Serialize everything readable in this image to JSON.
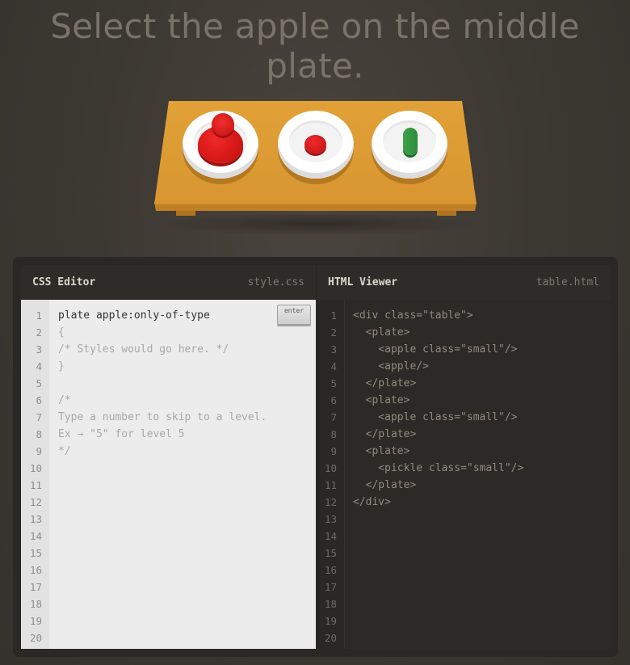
{
  "instruction": "Select the apple on the middle plate.",
  "css_editor": {
    "title": "CSS Editor",
    "file": "style.css",
    "input_value": "plate apple:only-of-type",
    "enter_label": "enter",
    "lines": [
      "{",
      "/* Styles would go here. */",
      "}",
      "",
      "/*",
      "Type a number to skip to a level.",
      "Ex → \"5\" for level 5",
      "*/"
    ],
    "line_numbers": [
      "1",
      "2",
      "3",
      "4",
      "5",
      "6",
      "7",
      "8",
      "9",
      "10",
      "11",
      "12",
      "13",
      "14",
      "15",
      "16",
      "17",
      "18",
      "19",
      "20"
    ]
  },
  "html_viewer": {
    "title": "HTML Viewer",
    "file": "table.html",
    "lines": [
      "<div class=\"table\">",
      "  <plate>",
      "    <apple class=\"small\"/>",
      "    <apple/>",
      "  </plate>",
      "  <plate>",
      "    <apple class=\"small\"/>",
      "  </plate>",
      "  <plate>",
      "    <pickle class=\"small\"/>",
      "  </plate>",
      "</div>"
    ],
    "line_numbers": [
      "1",
      "2",
      "3",
      "4",
      "5",
      "6",
      "7",
      "8",
      "9",
      "10",
      "11",
      "12",
      "13",
      "14",
      "15",
      "16",
      "17",
      "18",
      "19",
      "20"
    ]
  },
  "table_scene": {
    "items": [
      "plate-with-apples",
      "plate-with-small-apple",
      "plate-with-pickle"
    ],
    "colors": {
      "apple": "#d81818",
      "pickle": "#2f8f3a",
      "table": "#dc9a33"
    }
  }
}
